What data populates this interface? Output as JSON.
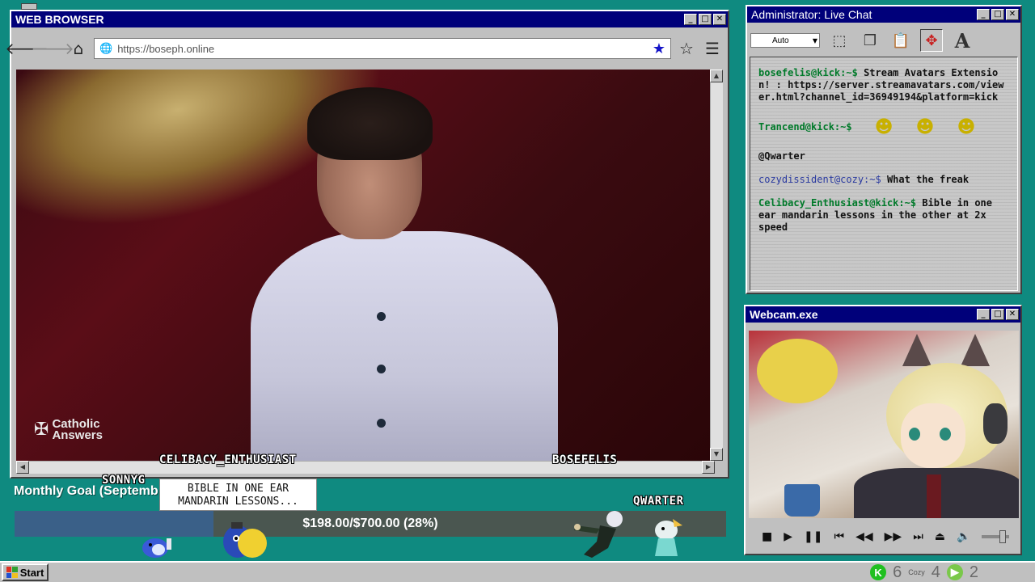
{
  "browser": {
    "title": "WEB BROWSER",
    "url": "https://boseph.online",
    "video_logo_line1": "Catholic",
    "video_logo_line2": "Answers"
  },
  "overlay": {
    "label_celibacy": "CELIBACY_ENTHUSIAST",
    "label_bosefelis": "BOSEFELIS",
    "label_sonny": "SONNYG",
    "label_qwarter": "QWARTER",
    "bubble_line1": "BIBLE IN ONE EAR",
    "bubble_line2": "MANDARIN LESSONS..."
  },
  "goal": {
    "title": "Monthly Goal (Septemb",
    "text": "$198.00/$700.00 (28%)",
    "progress": 0.28
  },
  "chat": {
    "title": "Administrator: Live Chat",
    "auto_select": "Auto",
    "messages": [
      {
        "user": "bosefelis@kick:~$",
        "text": "Stream Avatars Extension! : https://server.streamavatars.com/viewer.html?channel_id=36949194&platform=kick"
      },
      {
        "user": "Trancend@kick:~$",
        "text": ""
      },
      {
        "user": "",
        "text": "@Qwarter"
      },
      {
        "user": "cozydissident@cozy:~$",
        "text": "What the freak"
      },
      {
        "user": "Celibacy_Enthusiast@kick:~$",
        "text": "Bible in one ear mandarin lessons in the other at 2x speed"
      }
    ]
  },
  "webcam": {
    "title": "Webcam.exe"
  },
  "taskbar": {
    "start_label": "Start",
    "kick_count": "6",
    "cozy_label": "Cozy",
    "cozy_count": "4",
    "rumble_count": "2"
  },
  "colors": {
    "desktop": "#0f8a80",
    "titlebar": "#00007a",
    "chat_user_green": "#007a2a",
    "goal_fill": "#3a6088"
  }
}
